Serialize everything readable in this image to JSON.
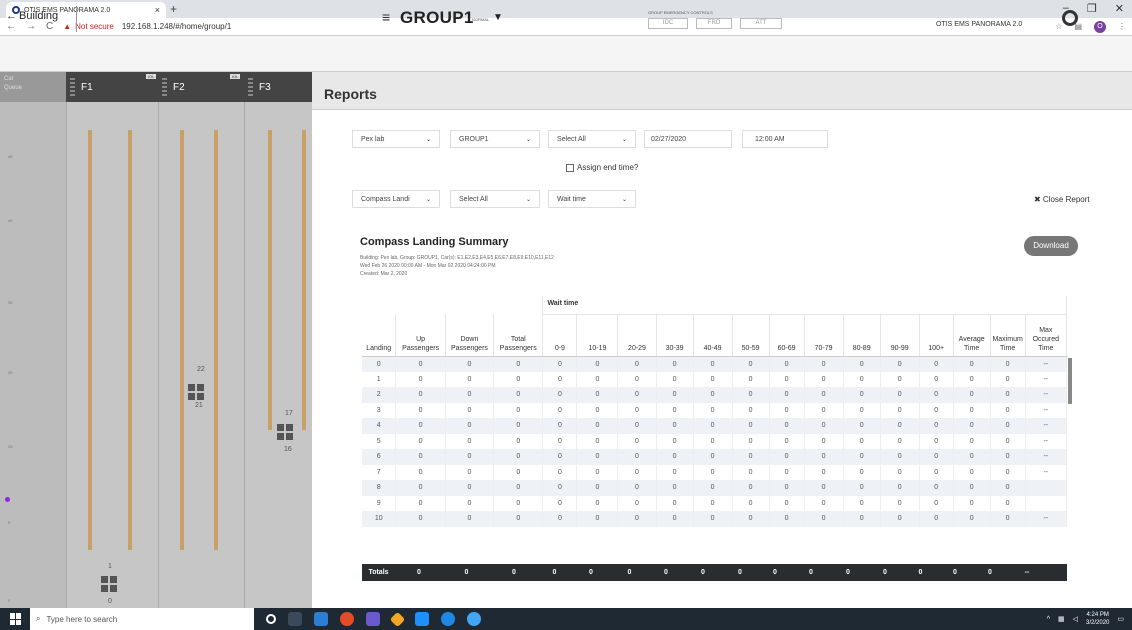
{
  "browser": {
    "tab_title": "OTIS EMS PANORAMA 2.0",
    "new_tab": "+",
    "address_warning": "Not secure",
    "url": "192.168.1.248/#/home/group/1",
    "window_controls": [
      "–",
      "❐",
      "✕"
    ],
    "profile_initial": "O"
  },
  "header": {
    "back_label": "Building",
    "group_title": "GROUP1",
    "group_mode": "NORMAL",
    "emergency_label": "GROUP EMERGENCY CONTROLS",
    "mode_buttons": [
      "IDC",
      "FRD",
      "ATT"
    ],
    "app_name": "OTIS EMS PANORAMA 2.0"
  },
  "left_panel": {
    "car_call_label": "Car\nQueue",
    "columns": [
      {
        "name": "F1",
        "tag": "IOL"
      },
      {
        "name": "F2",
        "tag": "IOL"
      },
      {
        "name": "F3",
        "tag": ""
      }
    ],
    "floor_labels": [
      "45",
      "40",
      "35",
      "30",
      "25",
      "20",
      "5",
      "0"
    ],
    "car_numbers": {
      "f2_top": "22",
      "f2_bottom": "21",
      "f3_top": "17",
      "f3_bottom": "16",
      "f1_top": "1",
      "f1_bottom": "0"
    }
  },
  "reports": {
    "title": "Reports",
    "filters_row1": {
      "building": "Pex lab",
      "group": "GROUP1",
      "cars": "Select All",
      "date": "02/27/2020",
      "time": "12:00 AM"
    },
    "assign_end_time": "Assign end time?",
    "filters_row2": {
      "report_type": "Compass Landi",
      "landings": "Select All",
      "metric": "Wait time"
    },
    "close_report": "✖ Close Report",
    "summary_title": "Compass Landing Summary",
    "building_info": "Building: Pex lab, Group: GROUP1, Car(s): E1,E2,E3,E4,E5,E6,E7,E8,E9,E10,E11,E12",
    "date_range": "Wed Feb 26 2020 00:00 AM - Mon Mar 02 2020 04:24:00 PM",
    "created": "Created: Mar 2, 2020",
    "download": "Download",
    "wait_time_group": "Wait time",
    "columns": [
      "Landing",
      "Up Passengers",
      "Down Passengers",
      "Total Passengers",
      "0-9",
      "10-19",
      "20-29",
      "30-39",
      "40-49",
      "50-59",
      "60-69",
      "70-79",
      "80-89",
      "90-99",
      "100+",
      "Average Time",
      "Maximum Time",
      "Max Occured Time"
    ],
    "rows": [
      [
        "0",
        "0",
        "0",
        "0",
        "0",
        "0",
        "0",
        "0",
        "0",
        "0",
        "0",
        "0",
        "0",
        "0",
        "0",
        "0",
        "0",
        "--"
      ],
      [
        "1",
        "0",
        "0",
        "0",
        "0",
        "0",
        "0",
        "0",
        "0",
        "0",
        "0",
        "0",
        "0",
        "0",
        "0",
        "0",
        "0",
        "--"
      ],
      [
        "2",
        "0",
        "0",
        "0",
        "0",
        "0",
        "0",
        "0",
        "0",
        "0",
        "0",
        "0",
        "0",
        "0",
        "0",
        "0",
        "0",
        "--"
      ],
      [
        "3",
        "0",
        "0",
        "0",
        "0",
        "0",
        "0",
        "0",
        "0",
        "0",
        "0",
        "0",
        "0",
        "0",
        "0",
        "0",
        "0",
        "--"
      ],
      [
        "4",
        "0",
        "0",
        "0",
        "0",
        "0",
        "0",
        "0",
        "0",
        "0",
        "0",
        "0",
        "0",
        "0",
        "0",
        "0",
        "0",
        "--"
      ],
      [
        "5",
        "0",
        "0",
        "0",
        "0",
        "0",
        "0",
        "0",
        "0",
        "0",
        "0",
        "0",
        "0",
        "0",
        "0",
        "0",
        "0",
        "--"
      ],
      [
        "6",
        "0",
        "0",
        "0",
        "0",
        "0",
        "0",
        "0",
        "0",
        "0",
        "0",
        "0",
        "0",
        "0",
        "0",
        "0",
        "0",
        "--"
      ],
      [
        "7",
        "0",
        "0",
        "0",
        "0",
        "0",
        "0",
        "0",
        "0",
        "0",
        "0",
        "0",
        "0",
        "0",
        "0",
        "0",
        "0",
        "--"
      ],
      [
        "8",
        "0",
        "0",
        "0",
        "0",
        "0",
        "0",
        "0",
        "0",
        "0",
        "0",
        "0",
        "0",
        "0",
        "0",
        "0",
        "0",
        ""
      ],
      [
        "9",
        "0",
        "0",
        "0",
        "0",
        "0",
        "0",
        "0",
        "0",
        "0",
        "0",
        "0",
        "0",
        "0",
        "0",
        "0",
        "0",
        ""
      ],
      [
        "10",
        "0",
        "0",
        "0",
        "0",
        "0",
        "0",
        "0",
        "0",
        "0",
        "0",
        "0",
        "0",
        "0",
        "0",
        "0",
        "0",
        "--"
      ]
    ],
    "totals": [
      "Totals",
      "0",
      "0",
      "0",
      "0",
      "0",
      "0",
      "0",
      "0",
      "0",
      "0",
      "0",
      "0",
      "0",
      "0",
      "0",
      "0",
      "--"
    ]
  },
  "taskbar": {
    "search_placeholder": "Type here to search",
    "time": "4:24 PM",
    "date": "3/2/2020"
  },
  "colors": {
    "accent_dark": "#2a2d30",
    "rail": "#c8a068",
    "download_btn": "#777777"
  }
}
